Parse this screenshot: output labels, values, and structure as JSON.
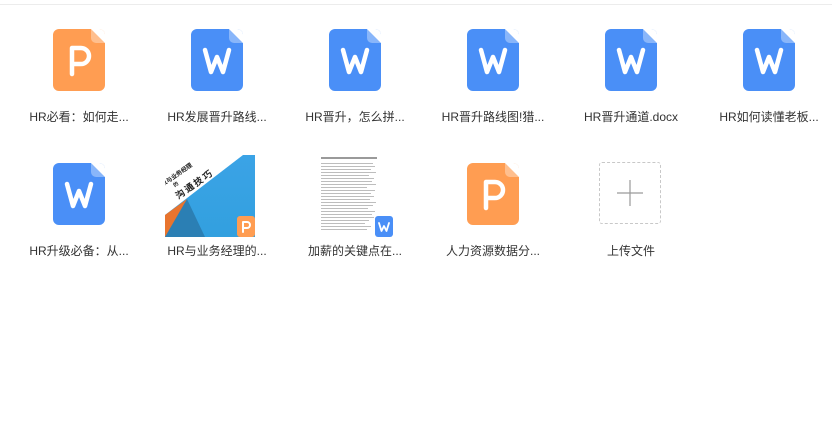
{
  "files": [
    {
      "name": "HR必看：如何走...",
      "type": "ppt",
      "icon": "ppt-file-icon"
    },
    {
      "name": "HR发展晋升路线...",
      "type": "word",
      "icon": "word-file-icon"
    },
    {
      "name": "HR晋升，怎么拼...",
      "type": "word",
      "icon": "word-file-icon"
    },
    {
      "name": "HR晋升路线图!猎...",
      "type": "word",
      "icon": "word-file-icon"
    },
    {
      "name": "HR晋升通道.docx",
      "type": "word",
      "icon": "word-file-icon"
    },
    {
      "name": "HR如何读懂老板...",
      "type": "word",
      "icon": "word-file-icon"
    },
    {
      "name": "HR升级必备：从...",
      "type": "word",
      "icon": "word-file-icon"
    },
    {
      "name": "HR与业务经理的...",
      "type": "ppt-thumb",
      "icon": "ppt-thumbnail",
      "thumb_lines": [
        "HR与业务经理",
        "的",
        "沟通技巧"
      ]
    },
    {
      "name": "加薪的关键点在...",
      "type": "word-thumb",
      "icon": "word-thumbnail"
    },
    {
      "name": "人力资源数据分...",
      "type": "ppt",
      "icon": "ppt-file-icon"
    }
  ],
  "upload": {
    "label": "上传文件",
    "icon": "plus-icon"
  },
  "colors": {
    "word": "#4a8ff7",
    "ppt": "#ff9d52",
    "text": "#333333"
  }
}
